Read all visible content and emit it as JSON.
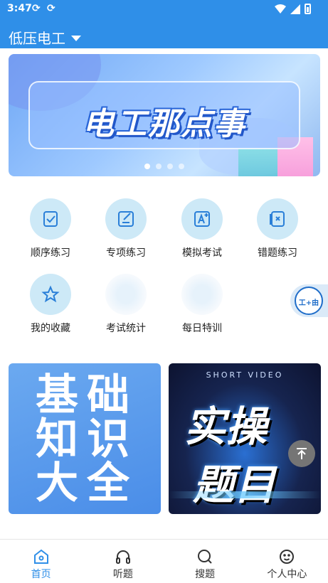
{
  "status_bar": {
    "time": "3:47",
    "sync_icons": [
      "⟳",
      "⟳"
    ]
  },
  "header": {
    "title": "低压电工"
  },
  "banner": {
    "text": "电工那点事",
    "dots": 4,
    "active_dot": 0
  },
  "grid": [
    {
      "label": "顺序练习",
      "icon": "checklist-icon"
    },
    {
      "label": "专项练习",
      "icon": "edit-note-icon"
    },
    {
      "label": "模拟考试",
      "icon": "exam-icon"
    },
    {
      "label": "错题练习",
      "icon": "wrong-question-icon"
    },
    {
      "label": "我的收藏",
      "icon": "star-icon"
    },
    {
      "label": "考试统计",
      "icon": "stats-icon"
    },
    {
      "label": "每日特训",
      "icon": "daily-training-icon"
    }
  ],
  "float_badge": {
    "text": "工+由"
  },
  "cards": {
    "left": {
      "text": "基础知识大全"
    },
    "right": {
      "subtitle": "SHORT VIDEO",
      "line1": "实操",
      "line2": "题目"
    }
  },
  "bottom_nav": [
    {
      "label": "首页",
      "icon": "home-icon",
      "active": true
    },
    {
      "label": "听题",
      "icon": "headphones-icon",
      "active": false
    },
    {
      "label": "搜题",
      "icon": "search-icon",
      "active": false
    },
    {
      "label": "个人中心",
      "icon": "profile-icon",
      "active": false
    }
  ],
  "colors": {
    "primary": "#2f8fe8",
    "icon_bg": "#cde9f7",
    "icon_stroke": "#2a7fd8"
  }
}
